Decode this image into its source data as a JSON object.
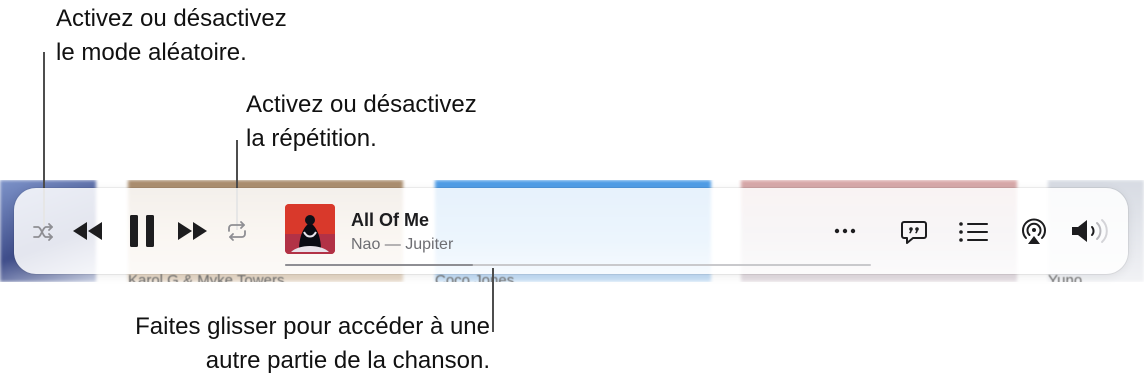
{
  "annotations": {
    "shuffle": [
      "Activez ou désactivez",
      "le mode aléatoire."
    ],
    "repeat": [
      "Activez ou désactivez",
      "la répétition."
    ],
    "scrub": [
      "Faites glisser pour accéder à une",
      "autre partie de la chanson."
    ]
  },
  "background_labels": [
    "Karol G & Myke Towers",
    "Coco Jones",
    "Yuno"
  ],
  "now_playing": {
    "title": "All Of Me",
    "subtitle": "Nao — Jupiter",
    "progress": 0.32
  },
  "icons": {
    "shuffle": "shuffle-icon",
    "rewind": "rewind-icon",
    "pause": "pause-icon",
    "forward": "fast-forward-icon",
    "repeat": "repeat-icon",
    "more": "ellipsis-icon",
    "lyrics": "lyrics-bubble-icon",
    "queue": "list-icon",
    "airplay": "airplay-audio-icon",
    "volume": "speaker-volume-icon"
  },
  "colors": {
    "control": "#1d1d1f",
    "inactive_control": "#8e8e93",
    "scrubber_track": "#c9c9cc"
  }
}
